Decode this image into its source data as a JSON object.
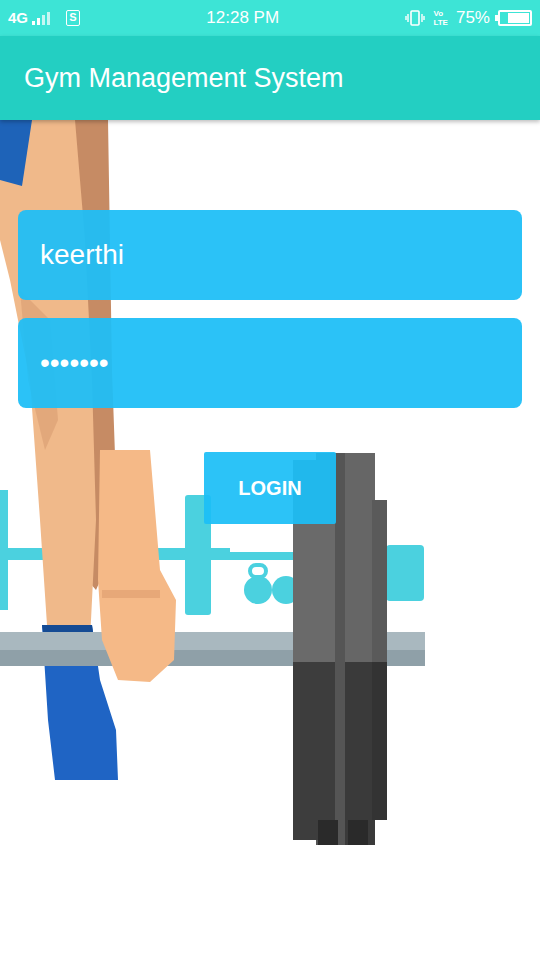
{
  "status_bar": {
    "network": "4G",
    "sim_icon": "S",
    "time": "12:28 PM",
    "volte": [
      "Vo",
      "LTE"
    ],
    "battery": "75%",
    "battery_level": 0.75
  },
  "app_bar": {
    "title": "Gym Management System"
  },
  "login": {
    "username": "keerthi",
    "password": "•••••••",
    "button": "LOGIN"
  }
}
